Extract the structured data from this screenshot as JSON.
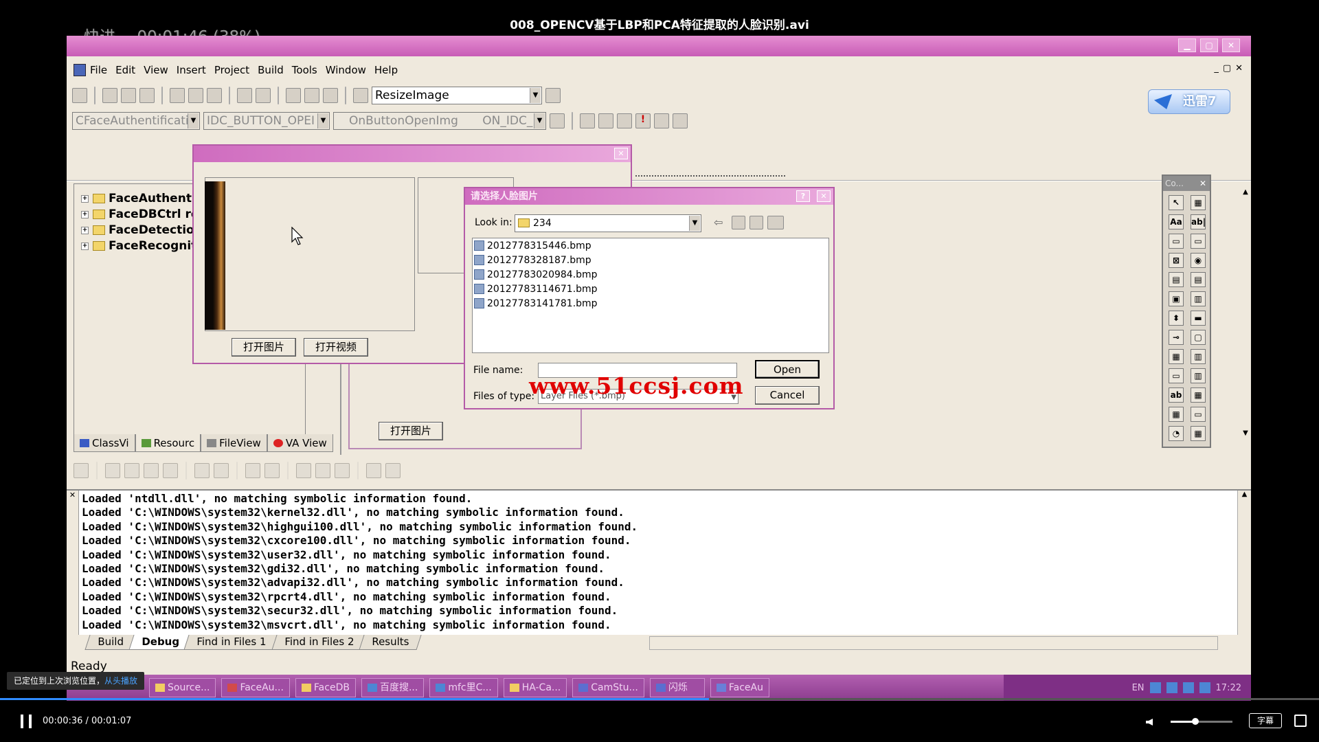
{
  "player": {
    "title": "008_OPENCV基于LBP和PCA特征提取的人脸识别.avi",
    "osd_mode": "快进",
    "osd_time": "00:01:46 (38%)",
    "time_display": "00:00:36 / 00:01:07",
    "progress_fraction": 0.5373,
    "volume_fraction": 0.4,
    "subtitle_label": "字幕",
    "toast_text": "已定位到上次浏览位置，",
    "toast_link": "从头播放"
  },
  "ide": {
    "menu": [
      "File",
      "Edit",
      "View",
      "Insert",
      "Project",
      "Build",
      "Tools",
      "Window",
      "Help"
    ],
    "func_combo": "ResizeImage",
    "class_combo": "CFaceAuthentificati",
    "id_combo": "IDC_BUTTON_OPEI",
    "handler_combo": "OnButtonOpenImg",
    "message_combo": "ON_IDC_B",
    "logo_text": "迅雷7",
    "tree_items": [
      "FaceAuthentifi",
      "FaceDBCtrl re",
      "FaceDetection",
      "FaceRecogniti"
    ],
    "workspace_tabs": [
      "ClassVi",
      "Resourc",
      "FileView",
      "VA View"
    ],
    "toolbox_title": "Co...",
    "toolbox_icons": [
      "↖",
      "▦",
      "Aa",
      "ab|",
      "▭",
      "▭",
      "⊠",
      "◉",
      "▤",
      "▤",
      "▣",
      "▥",
      "⬍",
      "▬",
      "⊸",
      "▢",
      "▦",
      "▥",
      "▭",
      "▥",
      "ab",
      "▦",
      "▦",
      "▭",
      "◔",
      "▦"
    ],
    "output_lines": [
      "Loaded 'ntdll.dll', no matching symbolic information found.",
      "Loaded 'C:\\WINDOWS\\system32\\kernel32.dll', no matching symbolic information found.",
      "Loaded 'C:\\WINDOWS\\system32\\highgui100.dll', no matching symbolic information found.",
      "Loaded 'C:\\WINDOWS\\system32\\cxcore100.dll', no matching symbolic information found.",
      "Loaded 'C:\\WINDOWS\\system32\\user32.dll', no matching symbolic information found.",
      "Loaded 'C:\\WINDOWS\\system32\\gdi32.dll', no matching symbolic information found.",
      "Loaded 'C:\\WINDOWS\\system32\\advapi32.dll', no matching symbolic information found.",
      "Loaded 'C:\\WINDOWS\\system32\\rpcrt4.dll', no matching symbolic information found.",
      "Loaded 'C:\\WINDOWS\\system32\\secur32.dll', no matching symbolic information found.",
      "Loaded 'C:\\WINDOWS\\system32\\msvcrt.dll', no matching symbolic information found."
    ],
    "output_tabs": [
      "Build",
      "Debug",
      "Find in Files 1",
      "Find in Files 2",
      "Results"
    ],
    "status": "Ready"
  },
  "app_dialog": {
    "btn_open_image": "打开图片",
    "btn_open_video": "打开视频",
    "bg_btn_open_image": "打开图片"
  },
  "file_dialog": {
    "title": "请选择人脸图片",
    "look_in_label": "Look in:",
    "look_in_value": "234",
    "files": [
      "2012778315446.bmp",
      "2012778328187.bmp",
      "20127783020984.bmp",
      "20127783114671.bmp",
      "20127783141781.bmp"
    ],
    "file_name_label": "File name:",
    "file_name_value": "",
    "file_type_label": "Files of type:",
    "file_type_value": "Layer Files (*.bmp)",
    "open_label": "Open",
    "cancel_label": "Cancel"
  },
  "watermark": "www.51ccsj.com",
  "taskbar": {
    "items": [
      "Source...",
      "FaceAu...",
      "FaceDB",
      "百度搜...",
      "mfc里C...",
      "HA-Ca...",
      "CamStu...",
      "闪烁",
      "FaceAu"
    ],
    "lang": "EN",
    "clock": "17:22"
  }
}
